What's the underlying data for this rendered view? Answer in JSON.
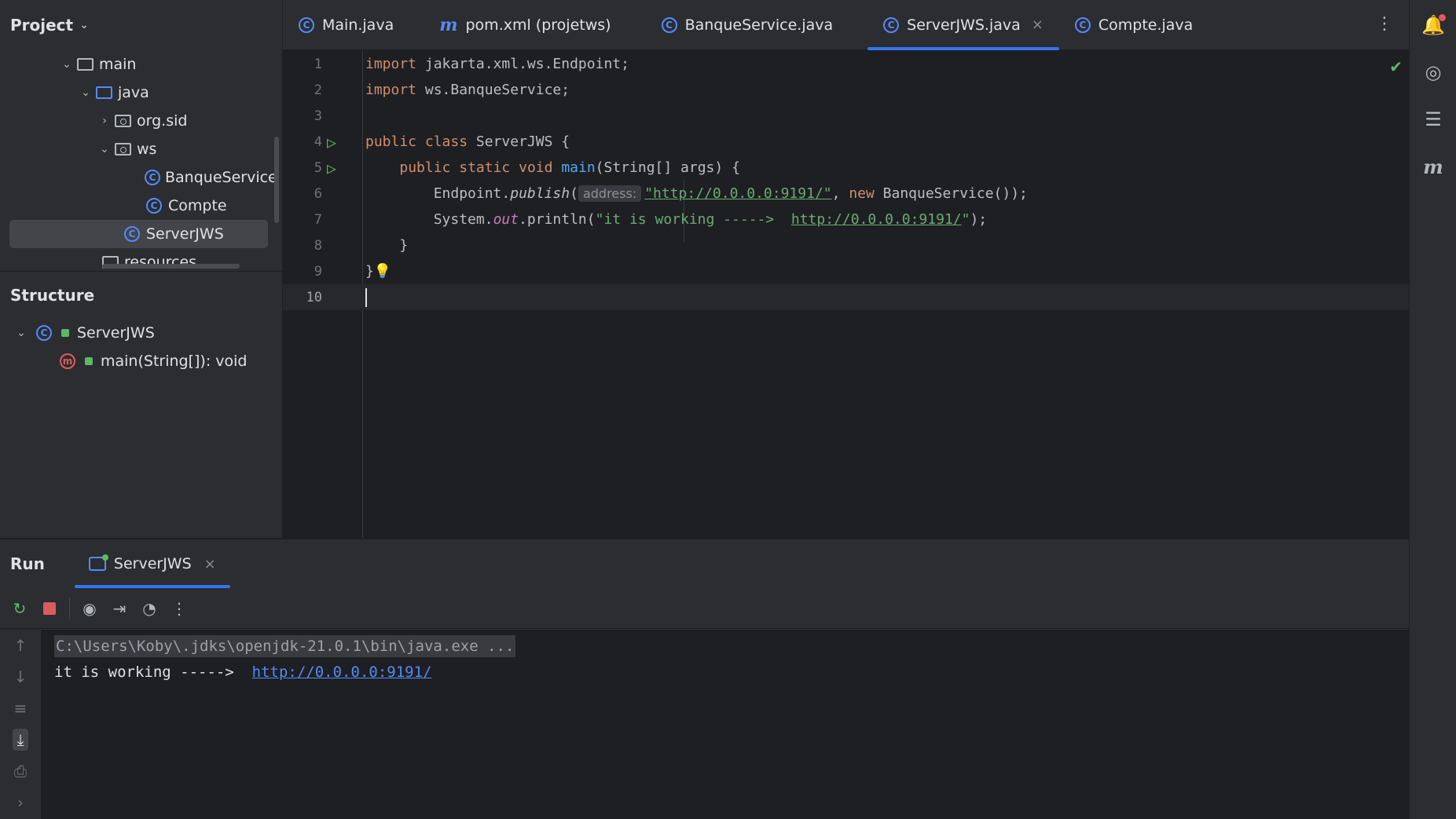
{
  "project": {
    "header": "Project",
    "tree": [
      {
        "label": "main"
      },
      {
        "label": "java"
      },
      {
        "label": "org.sid"
      },
      {
        "label": "ws"
      },
      {
        "label": "BanqueService"
      },
      {
        "label": "Compte"
      },
      {
        "label": "ServerJWS"
      },
      {
        "label": "resources"
      }
    ]
  },
  "structure": {
    "title": "Structure",
    "class_name": "ServerJWS",
    "method": "main(String[]): void"
  },
  "tabs": [
    {
      "label": "Main.java"
    },
    {
      "label": "pom.xml (projetws)"
    },
    {
      "label": "BanqueService.java"
    },
    {
      "label": "ServerJWS.java"
    },
    {
      "label": "Compte.java"
    }
  ],
  "editor": {
    "line_numbers": [
      "1",
      "2",
      "3",
      "4",
      "5",
      "6",
      "7",
      "8",
      "9",
      "10"
    ],
    "l1": {
      "kw": "import",
      "rest": " jakarta.xml.ws.Endpoint;"
    },
    "l2": {
      "kw": "import",
      "rest": " ws.BanqueService;"
    },
    "l4": {
      "kw1": "public",
      "kw2": "class",
      "rest": " ServerJWS {"
    },
    "l5": {
      "kw1": "public",
      "kw2": "static",
      "kw3": "void",
      "fn": "main",
      "rest": "(String[] args) {"
    },
    "l6": {
      "obj": "Endpoint.",
      "method": "publish",
      "open": "(",
      "hint": "address:",
      "str": "\"http://0.0.0.0:9191/\"",
      "comma": ", ",
      "kw": "new",
      "rest": " BanqueService());"
    },
    "l7": {
      "obj": "System.",
      "field": "out",
      "call": ".println(",
      "str": "\"it is working ----->  ",
      "link": "http://0.0.0.0:9191/",
      "end_str": "\"",
      "rest": ");"
    },
    "l8": "}",
    "l9": "}"
  },
  "run": {
    "title": "Run",
    "tab_label": "ServerJWS",
    "console": {
      "cmd": "C:\\Users\\Koby\\.jdks\\openjdk-21.0.1\\bin\\java.exe ...",
      "output_text": "it is working ----->  ",
      "output_link": "http://0.0.0.0:9191/"
    }
  },
  "colors": {
    "accent": "#3574f0",
    "keyword": "#cf8e6d",
    "string": "#6aab73",
    "function": "#56a8f5",
    "run_green": "#5fb865",
    "stop_red": "#db5c5c"
  }
}
